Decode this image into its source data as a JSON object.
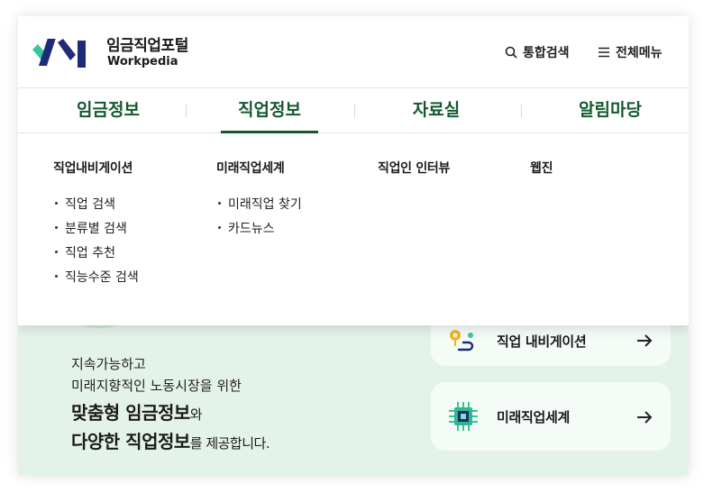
{
  "header": {
    "brand_ko": "임금직업포털",
    "brand_en": "Workpedia",
    "search_label": "통합검색",
    "menu_label": "전체메뉴"
  },
  "nav": {
    "items": [
      {
        "label": "임금정보"
      },
      {
        "label": "직업정보"
      },
      {
        "label": "자료실"
      },
      {
        "label": "알림마당"
      }
    ]
  },
  "dropdown": {
    "columns": [
      {
        "title": "직업내비게이션",
        "items": [
          "직업 검색",
          "분류별 검색",
          "직업 추천",
          "직능수준 검색"
        ]
      },
      {
        "title": "미래직업세계",
        "items": [
          "미래직업 찾기",
          "카드뉴스"
        ]
      },
      {
        "title": "직업인 인터뷰"
      },
      {
        "title": "웹진"
      }
    ]
  },
  "hero": {
    "line1": "지속가능하고",
    "line2": "미래지향적인 노동시장을 위한",
    "big1": "맞춤형 임금정보",
    "big1_suffix": "와",
    "big2": "다양한 직업정보",
    "big2_suffix": "를 제공합니다.",
    "cards": [
      {
        "label": "직업 내비게이션"
      },
      {
        "label": "미래직업세계"
      }
    ]
  },
  "colors": {
    "brand_green": "#155a2f",
    "logo_navy": "#1e2a7a",
    "logo_mint": "#38c79a",
    "hero_bg": "#e4f3ea"
  }
}
